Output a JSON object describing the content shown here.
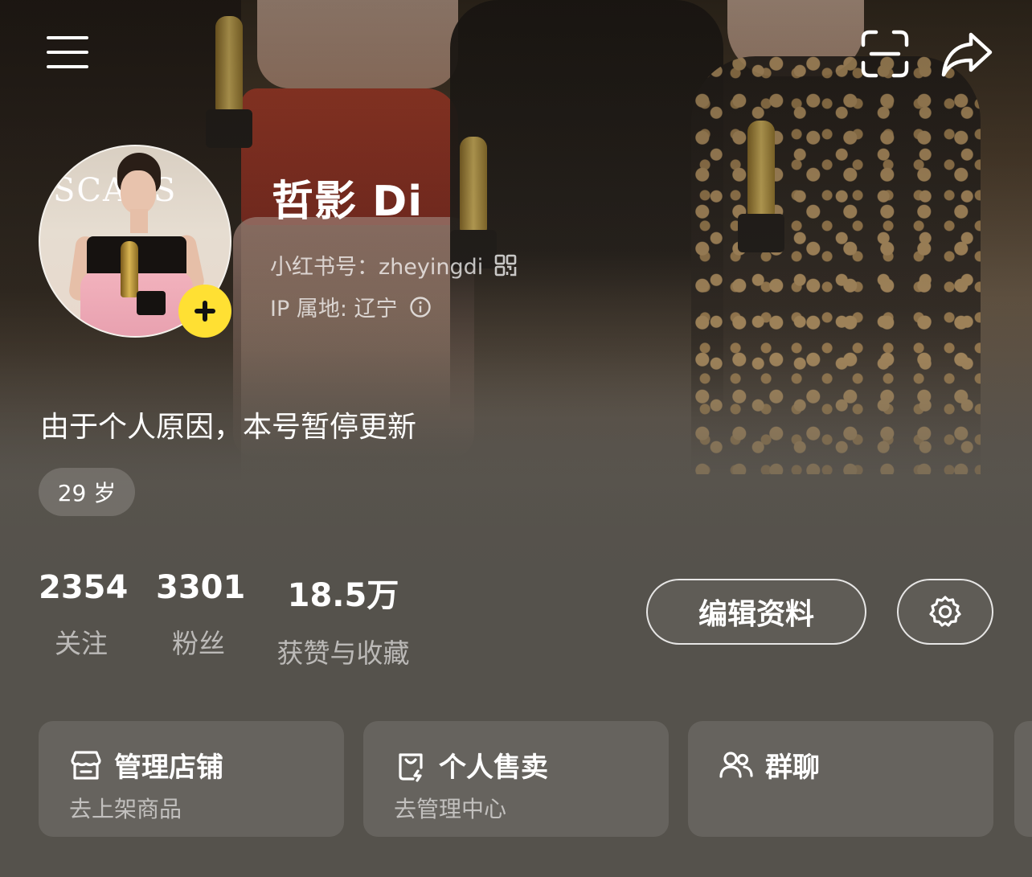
{
  "header": {
    "menu_icon": "menu-icon",
    "scan_icon": "scan-icon",
    "share_icon": "share-icon"
  },
  "profile": {
    "username": "哲影 Di",
    "id_label": "小红书号：",
    "id_value": "zheyingdi",
    "ip_label": "IP 属地: ",
    "ip_value": "辽宁",
    "avatar_logo_text": "SCARS",
    "bio": "由于个人原因，本号暂停更新",
    "age_tag": "29 岁",
    "accent_color": "#ffe033"
  },
  "stats": [
    {
      "value": "2354",
      "label": "关注"
    },
    {
      "value": "3301",
      "label": "粉丝"
    },
    {
      "value": "18.5万",
      "label": "获赞与收藏"
    }
  ],
  "actions": {
    "edit_profile": "编辑资料",
    "settings_icon": "gear-icon"
  },
  "cards": [
    {
      "icon": "store-icon",
      "title": "管理店铺",
      "subtitle": "去上架商品"
    },
    {
      "icon": "shopping-bag-icon",
      "title": "个人售卖",
      "subtitle": "去管理中心"
    },
    {
      "icon": "group-icon",
      "title": "群聊",
      "subtitle": ""
    }
  ]
}
